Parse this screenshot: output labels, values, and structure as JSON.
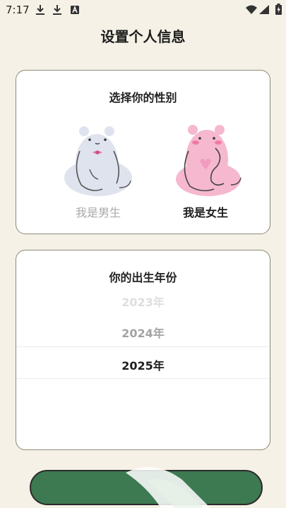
{
  "status_bar": {
    "time": "7:17",
    "icons": [
      "download-icon",
      "download-icon",
      "a-icon",
      "wifi-icon",
      "signal-icon",
      "battery-icon"
    ]
  },
  "page": {
    "title": "设置个人信息"
  },
  "gender_section": {
    "title": "选择你的性别",
    "options": [
      {
        "label": "我是男生",
        "icon": "male-bear-icon",
        "selected": false
      },
      {
        "label": "我是女生",
        "icon": "female-bear-icon",
        "selected": true
      }
    ]
  },
  "year_section": {
    "title": "你的出生年份",
    "years": [
      "2023年",
      "2024年",
      "2025年"
    ],
    "selected": "2025年"
  },
  "colors": {
    "background": "#f5f1e6",
    "button": "#3d7a52",
    "card_border": "#8d8a78",
    "male_bear": "#dfe3ee",
    "female_bear": "#f5b8cf"
  }
}
